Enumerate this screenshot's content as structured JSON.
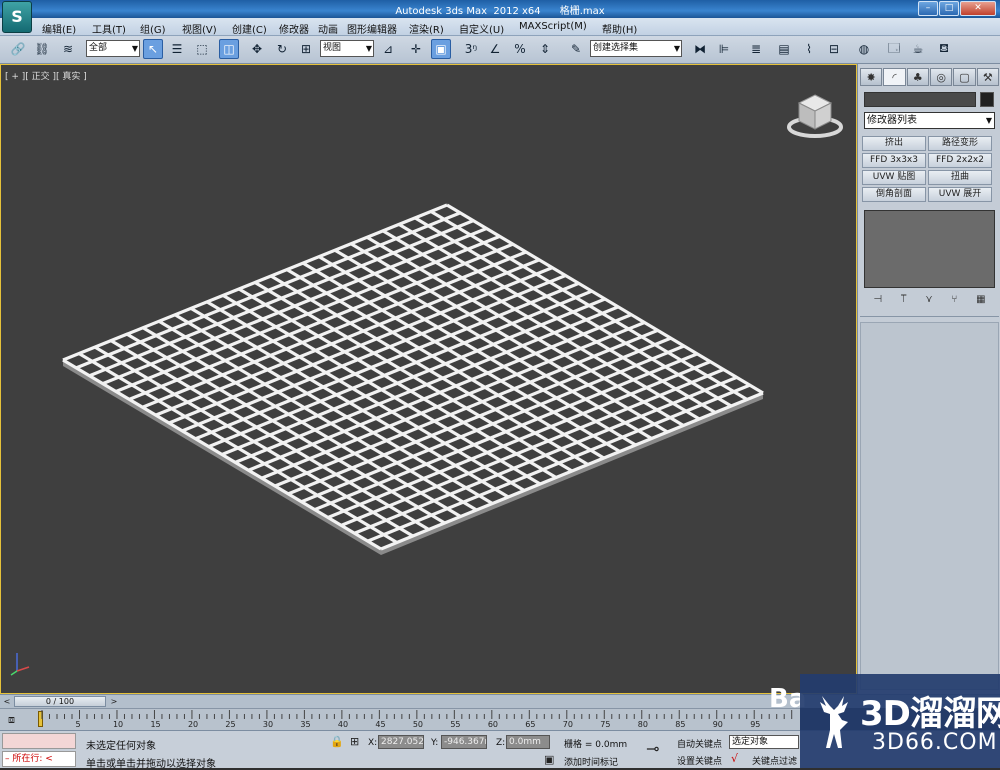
{
  "window": {
    "title": "Autodesk 3ds Max  2012 x64      格栅.max",
    "logo_letter": "S",
    "buttons": [
      "–",
      "□",
      "✕"
    ]
  },
  "menu": [
    "编辑(E)",
    "工具(T)",
    "组(G)",
    "视图(V)",
    "创建(C)",
    "修改器",
    "动画",
    "图形编辑器",
    "渲染(R)",
    "自定义(U)",
    "MAXScript(M)",
    "帮助(H)"
  ],
  "toolbar": {
    "selection_filter": "全部",
    "ref_coord": "视图",
    "named_selection": "创建选择集"
  },
  "viewport": {
    "label": "[ + ][ 正交 ][ 真实 ]"
  },
  "command_panel": {
    "modifier_list": "修改器列表",
    "buttons": [
      "挤出",
      "路径变形",
      "FFD 3x3x3",
      "FFD 2x2x2",
      "UVW 贴图",
      "扭曲",
      "倒角剖面",
      "UVW 展开"
    ]
  },
  "timeline": {
    "frame": "0 / 100",
    "ticks": [
      "5",
      "10",
      "15",
      "20",
      "25",
      "30",
      "35",
      "40",
      "45",
      "50",
      "55",
      "60",
      "65",
      "70",
      "75",
      "80",
      "85",
      "90",
      "95"
    ]
  },
  "status": {
    "script_label": "所在行:",
    "selection_text": "未选定任何对象",
    "prompt_text": "单击或单击并拖动以选择对象",
    "x_label": "X:",
    "x_value": "2827.052m",
    "y_label": "Y:",
    "y_value": "-946.367m",
    "z_label": "Z:",
    "z_value": "0.0mm",
    "grid": "栅格 = 0.0mm",
    "add_time_tag": "添加时间标记",
    "auto_key": "自动关键点",
    "set_key": "设置关键点",
    "selected_object": "选定对象",
    "key_filter": "关键点过滤"
  },
  "watermark": {
    "brand": "3D溜溜网",
    "site": "3D66.COM",
    "ba": "Ba"
  },
  "colors": {
    "viewport_bg": "#3f3f3f",
    "grid_frame": "#f2f2f2",
    "accent": "#e6c23a"
  }
}
